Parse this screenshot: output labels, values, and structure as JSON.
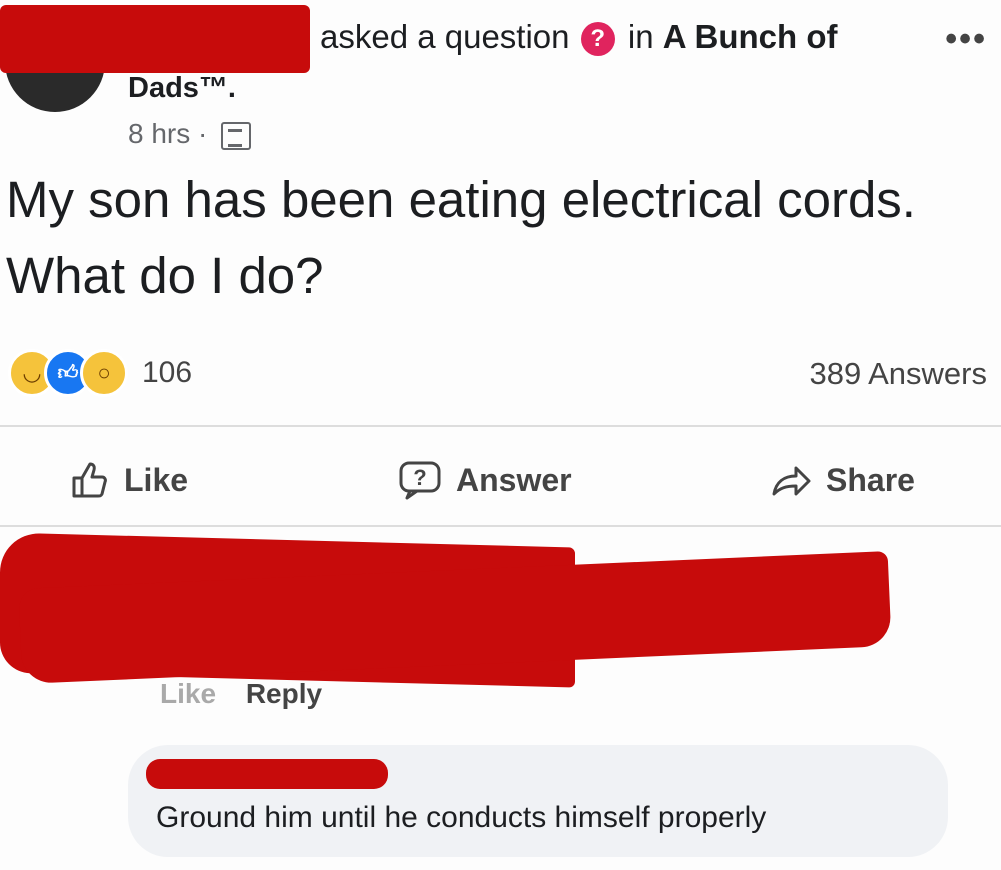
{
  "post": {
    "header_asked": "asked a question",
    "question_badge": "?",
    "header_in": "in",
    "group_name": "A Bunch of",
    "group_name_tail": "Dads™.",
    "more_label": "•••",
    "timestamp": "8 hrs ·",
    "audience_icon": "group-icon",
    "question": "My son has been eating electrical cords. What do I do?"
  },
  "stats": {
    "reactions": [
      "haha",
      "like",
      "wow"
    ],
    "reaction_count": "106",
    "answers_count": "389 Answers"
  },
  "actions": {
    "like": "Like",
    "answer": "Answer",
    "share": "Share"
  },
  "comment": {
    "like": "Like",
    "reply": "Reply"
  },
  "reply": {
    "text": "Ground him until he conducts himself properly"
  },
  "colors": {
    "redaction": "#c70b0b",
    "question_badge": "#e0245e",
    "like_blue": "#1877f2"
  }
}
